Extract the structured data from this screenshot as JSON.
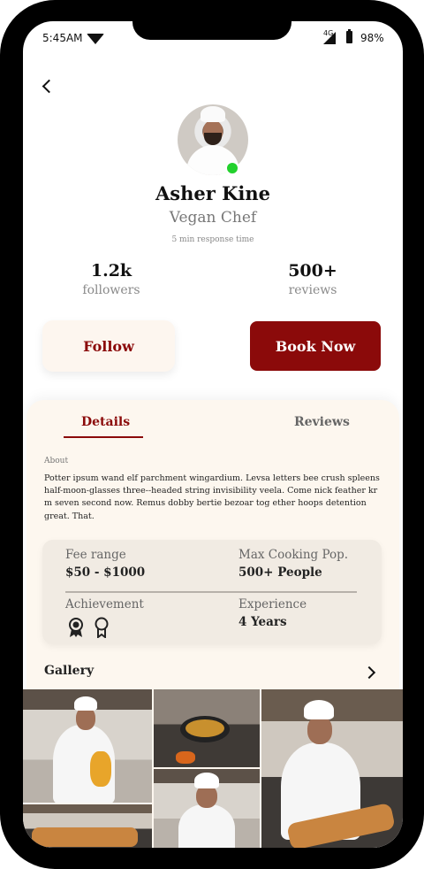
{
  "status_bar": {
    "time": "5:45AM",
    "network": "4G",
    "battery": "98%",
    "icons": [
      "wifi-icon",
      "signal-icon",
      "battery-icon"
    ]
  },
  "nav": {
    "back_icon": "chevron-left-icon"
  },
  "profile": {
    "name": "Asher Kine",
    "role": "Vegan Chef",
    "response_time": "5 min response time",
    "online": true
  },
  "stats": [
    {
      "value": "1.2k",
      "label": "followers"
    },
    {
      "value": "500+",
      "label": "reviews"
    }
  ],
  "actions": {
    "follow_label": "Follow",
    "book_label": "Book Now"
  },
  "tabs": [
    {
      "label": "Details",
      "active": true
    },
    {
      "label": "Reviews",
      "active": false
    }
  ],
  "about": {
    "label": "About",
    "text": "Potter ipsum wand elf parchment wingardium. Levsa letters bee crush spleens half-moon-glasses three--headed string invisibility veela. Come nick feather kr m seven second now. Remus dobby bertie bezoar tog ether hoops detention great. That."
  },
  "info": {
    "fee_label": "Fee range",
    "fee_value": "$50 - $1000",
    "max_label": "Max Cooking Pop.",
    "max_value": "500+ People",
    "achievement_label": "Achievement",
    "achievement_icons": [
      "award-ribbon-icon",
      "medal-icon"
    ],
    "experience_label": "Experience",
    "experience_value": "4 Years"
  },
  "gallery": {
    "label": "Gallery",
    "more_icon": "chevron-right-icon",
    "photos": [
      "chef-dough-photo",
      "chef-cooking-pan-photo",
      "chef-baking-tray-photo",
      "chef-portrait-photo",
      "baked-bread-photo"
    ]
  },
  "colors": {
    "accent": "#8b0a0a",
    "panel_bg": "#fdf7ef",
    "online": "#23d12d"
  }
}
